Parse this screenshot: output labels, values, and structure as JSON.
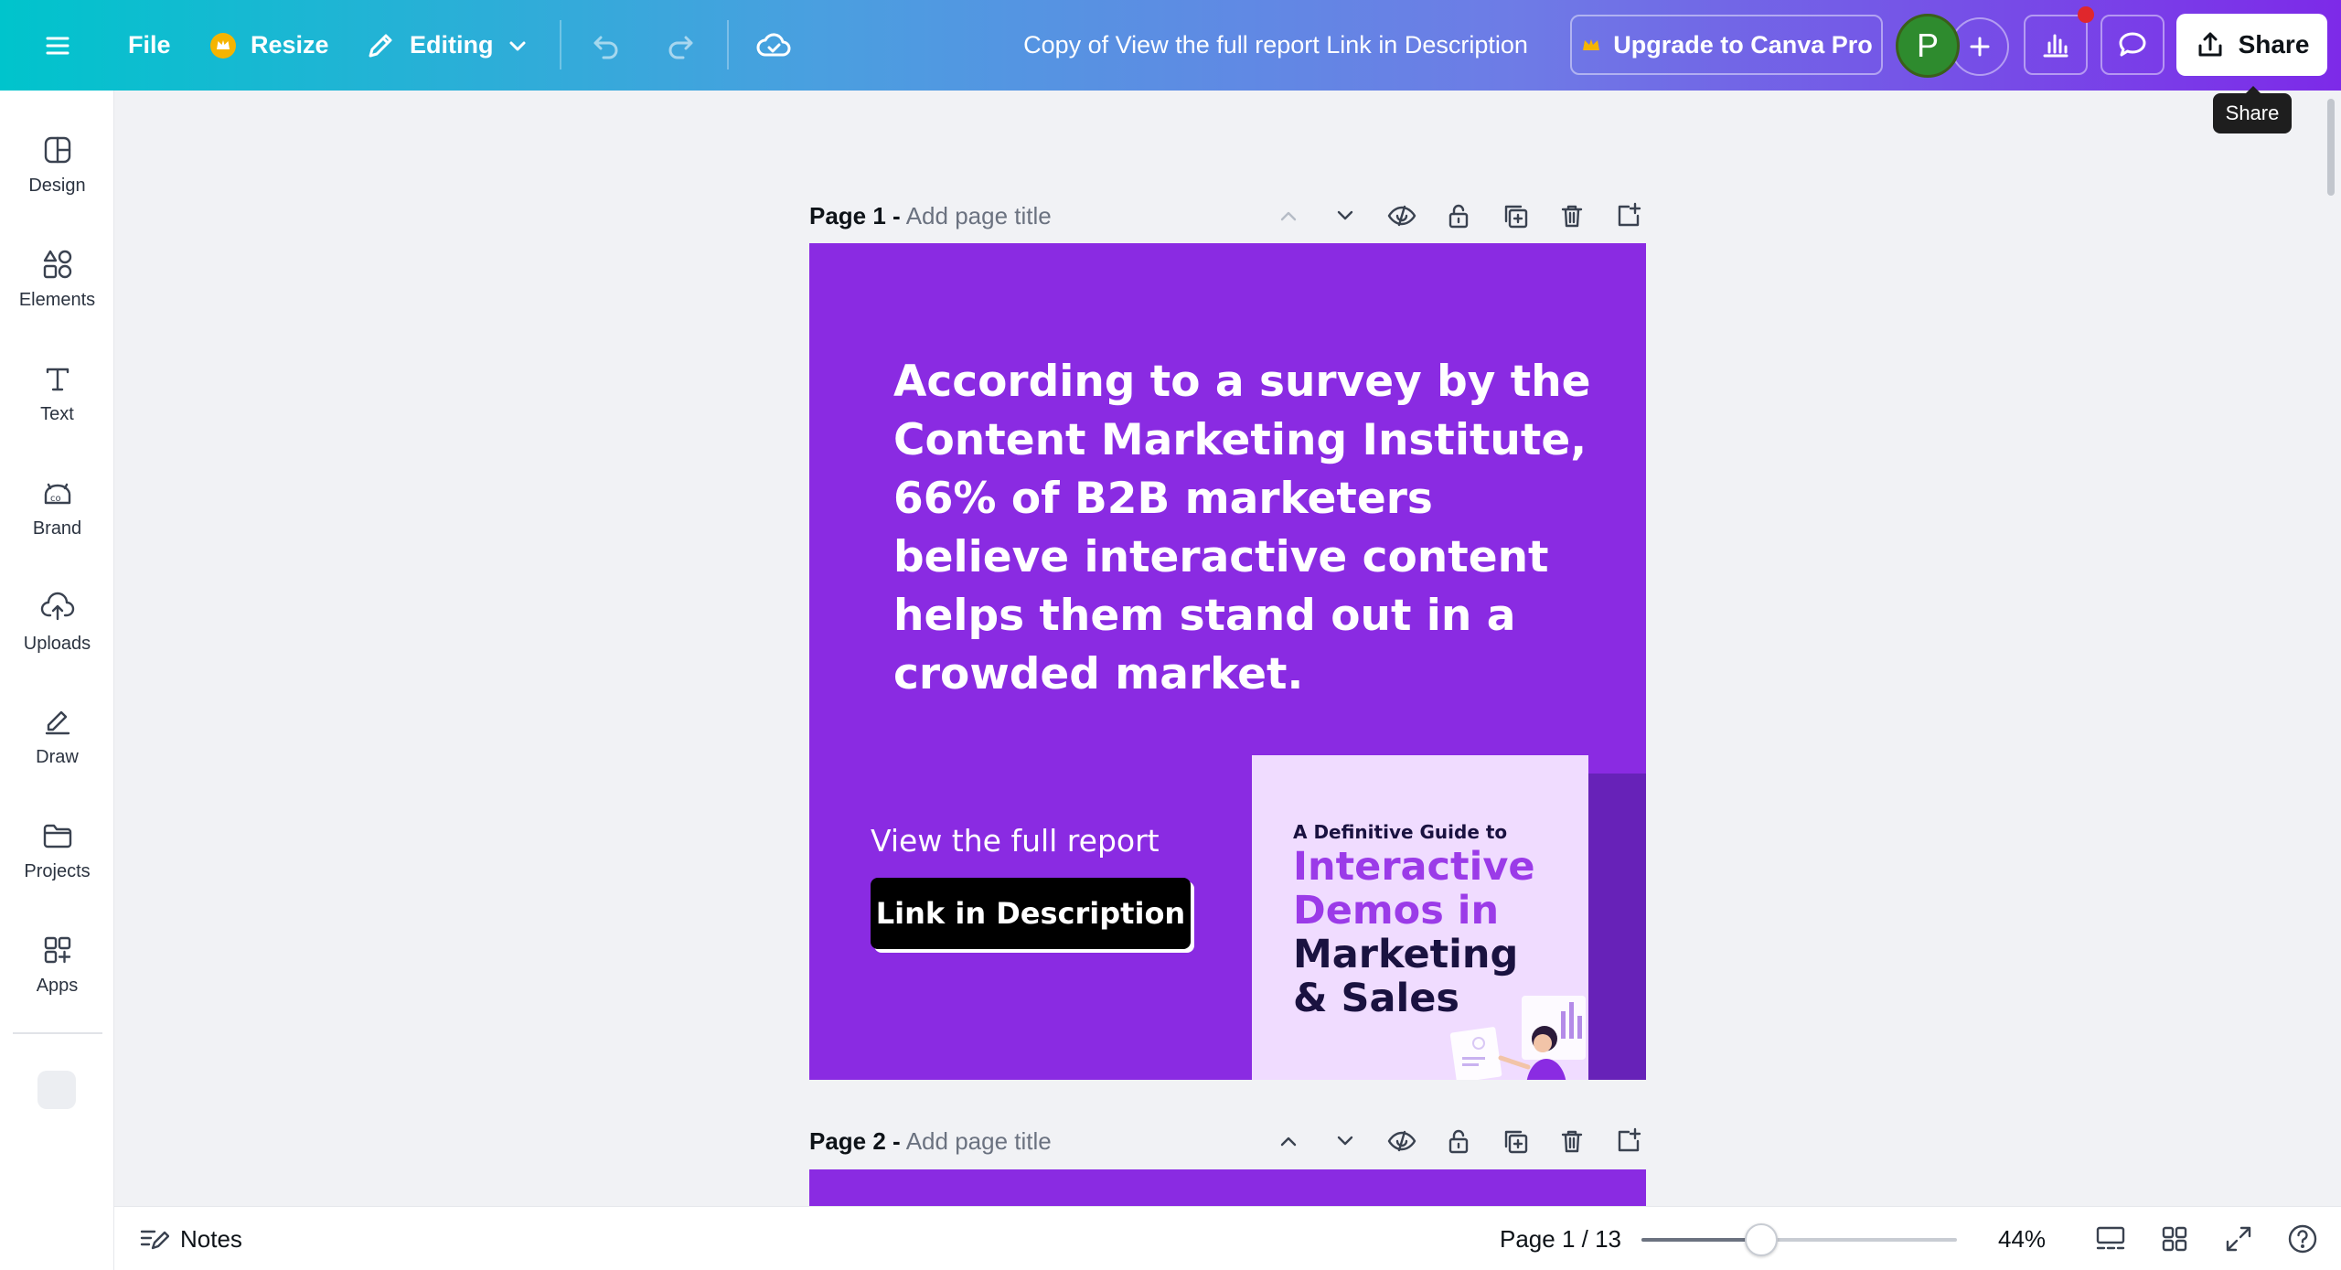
{
  "topbar": {
    "file_label": "File",
    "resize_label": "Resize",
    "editing_label": "Editing",
    "document_title": "Copy of View the full report Link in Description",
    "upgrade_label": "Upgrade to Canva Pro",
    "avatar_initial": "P",
    "share_label": "Share",
    "share_tooltip": "Share"
  },
  "sidebar": {
    "items": [
      {
        "label": "Design",
        "icon": "design-icon"
      },
      {
        "label": "Elements",
        "icon": "elements-icon"
      },
      {
        "label": "Text",
        "icon": "text-icon"
      },
      {
        "label": "Brand",
        "icon": "brand-icon"
      },
      {
        "label": "Uploads",
        "icon": "cloud-upload-icon"
      },
      {
        "label": "Draw",
        "icon": "draw-icon"
      },
      {
        "label": "Projects",
        "icon": "folder-icon"
      },
      {
        "label": "Apps",
        "icon": "apps-icon"
      }
    ]
  },
  "pages": [
    {
      "label": "Page 1 -",
      "title_placeholder": "Add page title"
    },
    {
      "label": "Page 2 -",
      "title_placeholder": "Add page title"
    }
  ],
  "canvas": {
    "headline": "According to a survey by the Content Marketing Institute, 66% of B2B marketers believe interactive content helps them stand out in a crowded market.",
    "view_report": "View the full report",
    "link_button": "Link in Description",
    "cover": {
      "kicker": "A Definitive Guide to",
      "line1": "Interactive",
      "line2": "Demos in",
      "line3": "Marketing",
      "line4": "& Sales"
    },
    "colors": {
      "background": "#8a2be2",
      "cover_bg": "#f0dcff",
      "accent": "#9b3be8"
    }
  },
  "bottombar": {
    "notes_label": "Notes",
    "page_count": "Page 1 / 13",
    "zoom_level": "44%",
    "zoom_fraction": 0.38
  }
}
